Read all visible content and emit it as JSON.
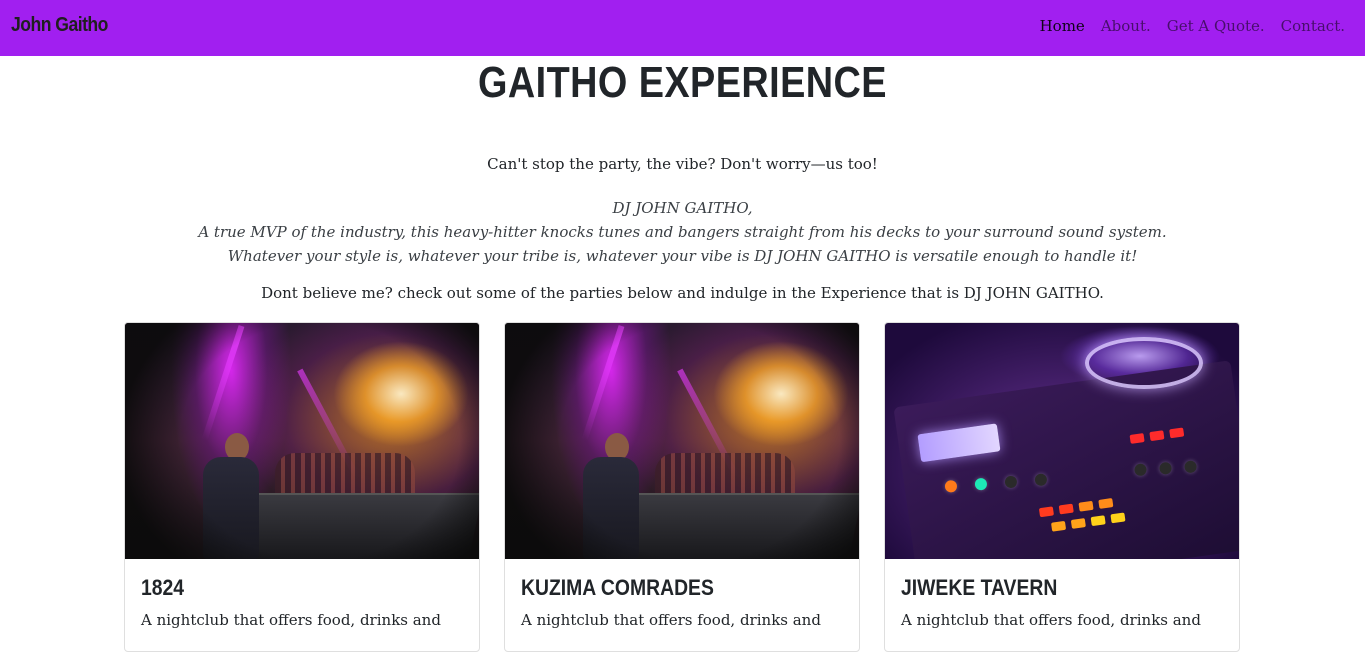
{
  "nav": {
    "brand": "John Gaitho",
    "links": [
      "Home",
      "About.",
      "Get A Quote.",
      "Contact."
    ]
  },
  "hero": {
    "title": "GAITHO EXPERIENCE",
    "tagline": "Can't stop the party, the vibe? Don't worry—us too!",
    "quote_lines": [
      "DJ JOHN GAITHO,",
      "A true MVP of the industry, this heavy-hitter knocks tunes and bangers straight from his decks to your surround sound system.",
      "Whatever your style is, whatever your tribe is, whatever your vibe is DJ JOHN GAITHO is versatile enough to handle it!"
    ],
    "cta": "Dont believe me? check out some of the parties below and indulge in the Experience that is DJ JOHN GAITHO."
  },
  "cards": [
    {
      "title": "1824",
      "text": "A nightclub that offers food, drinks and",
      "image": "dj-performance-image"
    },
    {
      "title": "KUZIMA COMRADES",
      "text": "A nightclub that offers food, drinks and",
      "image": "dj-performance-image"
    },
    {
      "title": "JIWEKE TAVERN",
      "text": "A nightclub that offers food, drinks and",
      "image": "dj-mixer-image"
    }
  ],
  "colors": {
    "navbar": "#a11ff0",
    "text": "#212529"
  }
}
